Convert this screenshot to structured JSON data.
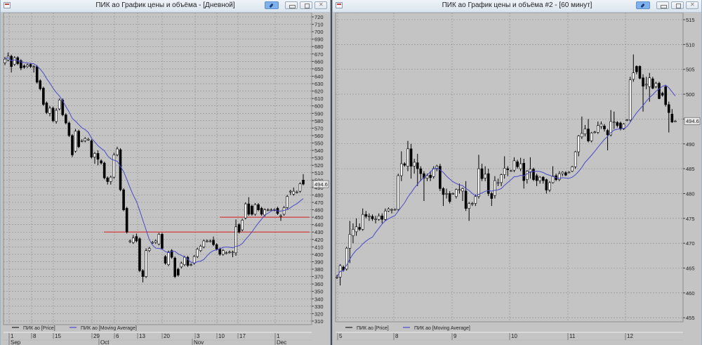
{
  "colors": {
    "plot_bg": "#c4c4c4",
    "grid": "#8c8c8c",
    "ma_line": "#4a4ac8",
    "level_line": "#d23c3c",
    "up_body": "#ffffff",
    "down_body": "#000000"
  },
  "left_window": {
    "title": "ПИК ао График цены и объёма - [Дневной]",
    "buttons": {
      "pin": "pin-icon",
      "minimize": "minimize-icon",
      "maximize": "maximize-icon",
      "close": "close-icon"
    },
    "legend": {
      "price": "ПИК ао [Price]",
      "ma": "ПИК ао [Moving Average]"
    },
    "last_price": "494.6",
    "chart_data": {
      "type": "candlestick",
      "ylim": [
        310,
        720
      ],
      "y_ticks": [
        "720",
        "710",
        "700",
        "690",
        "680",
        "670",
        "660",
        "650",
        "640",
        "630",
        "620",
        "610",
        "600",
        "590",
        "580",
        "570",
        "560",
        "550",
        "540",
        "530",
        "520",
        "510",
        "500",
        "490",
        "480",
        "470",
        "460",
        "450",
        "440",
        "430",
        "420",
        "410",
        "400",
        "390",
        "380",
        "370",
        "360",
        "350",
        "340",
        "330",
        "320",
        "310"
      ],
      "x_day_labels": [
        "1",
        "8",
        "15",
        "29",
        "6",
        "13",
        "20",
        "3",
        "10",
        "17",
        "1"
      ],
      "x_month_labels": [
        "Sep",
        "Oct",
        "Nov",
        "Dec"
      ],
      "grid": true,
      "horizontal_levels": [
        430,
        450
      ],
      "ohlc": [
        [
          658,
          666,
          655,
          663
        ],
        [
          662,
          672,
          660,
          667
        ],
        [
          667,
          669,
          645,
          653
        ],
        [
          656,
          667,
          654,
          665
        ],
        [
          665,
          667,
          655,
          657
        ],
        [
          661,
          663,
          648,
          651
        ],
        [
          654,
          656,
          650,
          652
        ],
        [
          653,
          657,
          651,
          655
        ],
        [
          656,
          658,
          651,
          653
        ],
        [
          653,
          655,
          645,
          653
        ],
        [
          653,
          655,
          630,
          632
        ],
        [
          634,
          636,
          621,
          623
        ],
        [
          624,
          626,
          600,
          602
        ],
        [
          604,
          606,
          589,
          591
        ],
        [
          590,
          600,
          586,
          597
        ],
        [
          597,
          599,
          578,
          580
        ],
        [
          579,
          597,
          576,
          594
        ],
        [
          596,
          610,
          594,
          608
        ],
        [
          608,
          610,
          586,
          588
        ],
        [
          588,
          590,
          575,
          577
        ],
        [
          577,
          579,
          558,
          560
        ],
        [
          560,
          562,
          531,
          534
        ],
        [
          539,
          569,
          537,
          566
        ],
        [
          566,
          568,
          543,
          545
        ],
        [
          553,
          555,
          551,
          553
        ],
        [
          553,
          558,
          551,
          556
        ],
        [
          555,
          557,
          553,
          555
        ],
        [
          553,
          555,
          529,
          531
        ],
        [
          531,
          538,
          522,
          536
        ],
        [
          536,
          540,
          520,
          528
        ],
        [
          526,
          528,
          521,
          523
        ],
        [
          523,
          525,
          501,
          503
        ],
        [
          503,
          505,
          494,
          498
        ],
        [
          498,
          506,
          494,
          504
        ],
        [
          504,
          537,
          502,
          534
        ],
        [
          534,
          545,
          532,
          542
        ],
        [
          541,
          543,
          485,
          487
        ],
        [
          487,
          489,
          458,
          460
        ],
        [
          462,
          464,
          428,
          430
        ],
        [
          418,
          420,
          415,
          418
        ],
        [
          416,
          426,
          414,
          422
        ],
        [
          424,
          428,
          416,
          418
        ],
        [
          421,
          423,
          376,
          378
        ],
        [
          378,
          380,
          362,
          370
        ],
        [
          370,
          408,
          368,
          405
        ],
        [
          405,
          410,
          403,
          408
        ],
        [
          416,
          418,
          414,
          416
        ],
        [
          416,
          420,
          414,
          418
        ],
        [
          414,
          429,
          412,
          427
        ],
        [
          427,
          429,
          406,
          408
        ],
        [
          397,
          399,
          386,
          388
        ],
        [
          386,
          405,
          384,
          403
        ],
        [
          405,
          407,
          394,
          396
        ],
        [
          395,
          397,
          368,
          370
        ],
        [
          380,
          382,
          370,
          372
        ],
        [
          383,
          390,
          381,
          388
        ],
        [
          386,
          398,
          384,
          396
        ],
        [
          396,
          398,
          383,
          385
        ],
        [
          386,
          388,
          384,
          386
        ],
        [
          388,
          399,
          386,
          397
        ],
        [
          397,
          409,
          395,
          407
        ],
        [
          405,
          413,
          403,
          411
        ],
        [
          410,
          420,
          408,
          418
        ],
        [
          418,
          420,
          416,
          418
        ],
        [
          418,
          420,
          416,
          418
        ],
        [
          419,
          424,
          411,
          413
        ],
        [
          413,
          415,
          405,
          407
        ],
        [
          407,
          409,
          398,
          400
        ],
        [
          400,
          407,
          398,
          405
        ],
        [
          402,
          404,
          400,
          402
        ],
        [
          403,
          405,
          401,
          403
        ],
        [
          403,
          405,
          396,
          403
        ],
        [
          402,
          447,
          398,
          437
        ],
        [
          440,
          442,
          428,
          430
        ],
        [
          433,
          448,
          431,
          446
        ],
        [
          449,
          470,
          447,
          468
        ],
        [
          468,
          477,
          452,
          454
        ],
        [
          465,
          467,
          452,
          454
        ],
        [
          454,
          469,
          452,
          467
        ],
        [
          467,
          469,
          458,
          460
        ],
        [
          462,
          464,
          452,
          454
        ],
        [
          453,
          462,
          451,
          460
        ],
        [
          460,
          462,
          458,
          460
        ],
        [
          460,
          462,
          458,
          460
        ],
        [
          460,
          462,
          458,
          460
        ],
        [
          462,
          464,
          453,
          455
        ],
        [
          452,
          454,
          445,
          452
        ],
        [
          454,
          465,
          452,
          463
        ],
        [
          463,
          480,
          461,
          478
        ],
        [
          485,
          487,
          480,
          485
        ],
        [
          481,
          490,
          479,
          485
        ],
        [
          484,
          486,
          482,
          484
        ],
        [
          485,
          497,
          483,
          495
        ],
        [
          500,
          508,
          493,
          494.6
        ]
      ]
    }
  },
  "right_window": {
    "title": "ПИК ао График цены и объёма #2 - [60 минут]",
    "buttons": {
      "pin": "pin-icon",
      "minimize": "minimize-icon",
      "maximize": "maximize-icon",
      "close": "close-icon"
    },
    "legend": {
      "price": "ПИК ао [Price]",
      "ma": "ПИК ао [Moving Average]"
    },
    "last_price": "494.6",
    "chart_data": {
      "type": "candlestick",
      "ylim": [
        455,
        515
      ],
      "y_ticks": [
        "515",
        "510",
        "505",
        "500",
        "495",
        "490",
        "485",
        "480",
        "475",
        "470",
        "465",
        "460",
        "455"
      ],
      "x_day_labels": [
        "5",
        "8",
        "9",
        "10",
        "11",
        "12"
      ],
      "grid": true,
      "ohlc": [
        [
          463.2,
          463.6,
          462.8,
          463.2
        ],
        [
          463.2,
          465.8,
          461.5,
          465.5
        ],
        [
          465.2,
          465.5,
          464.3,
          464.6
        ],
        [
          464.8,
          469.3,
          464.5,
          469
        ],
        [
          469,
          474.5,
          466,
          471.8
        ],
        [
          471.5,
          474,
          470,
          472.8
        ],
        [
          472.3,
          475,
          471.5,
          473.3
        ],
        [
          473.2,
          474,
          472.5,
          472.8
        ],
        [
          472.8,
          477,
          472.5,
          475.8
        ],
        [
          475.8,
          476.5,
          475,
          475.4
        ],
        [
          475.5,
          476,
          474.5,
          475.5
        ],
        [
          475.4,
          475.8,
          474.5,
          474.9
        ],
        [
          474.9,
          475.5,
          474,
          474.9
        ],
        [
          474.8,
          476,
          474.5,
          475.5
        ],
        [
          475.5,
          476,
          474,
          474.8
        ],
        [
          474.8,
          477,
          474.5,
          476.5
        ],
        [
          476.5,
          477.2,
          476.3,
          476.9
        ],
        [
          476.8,
          477,
          476,
          476.8
        ],
        [
          476.8,
          477,
          476.6,
          476.8
        ],
        [
          476.8,
          484,
          476.6,
          483.6
        ],
        [
          483.6,
          488.5,
          482.5,
          486
        ],
        [
          486,
          486.3,
          485.4,
          485.7
        ],
        [
          485.5,
          490.6,
          484.5,
          489
        ],
        [
          489,
          490,
          483,
          485.5
        ],
        [
          485.5,
          487,
          484,
          486.3
        ],
        [
          486.2,
          488,
          481.5,
          485
        ],
        [
          485,
          485.5,
          482.5,
          484
        ],
        [
          484,
          484.5,
          478.5,
          483.1
        ],
        [
          483.1,
          484,
          482.5,
          483.6
        ],
        [
          483.7,
          484.5,
          482.5,
          483.2
        ],
        [
          483.4,
          485.5,
          483,
          485
        ],
        [
          485,
          485.8,
          484.5,
          485.5
        ],
        [
          485.5,
          486,
          480.5,
          481
        ],
        [
          481,
          481.3,
          477.5,
          479.8
        ],
        [
          480,
          481,
          479,
          480
        ],
        [
          480,
          480.5,
          478,
          478.4
        ],
        [
          480,
          480.2,
          479.8,
          480
        ],
        [
          479.4,
          481,
          479,
          480.8
        ],
        [
          480.8,
          482,
          480,
          480.8
        ],
        [
          480.5,
          481.2,
          478.5,
          481
        ],
        [
          480.5,
          482.5,
          476.5,
          477
        ],
        [
          477,
          478.3,
          474.5,
          478
        ],
        [
          478,
          478.3,
          477.5,
          478
        ],
        [
          478,
          479.8,
          477.5,
          479.4
        ],
        [
          479.4,
          487.8,
          479,
          485
        ],
        [
          485,
          486,
          482.5,
          483
        ],
        [
          483.1,
          485.5,
          482.5,
          483.9
        ],
        [
          484,
          485,
          479.5,
          480
        ],
        [
          480,
          480.3,
          477.5,
          479
        ],
        [
          479.6,
          483.5,
          479,
          482.6
        ],
        [
          482.2,
          483,
          481.5,
          482.2
        ],
        [
          482.2,
          484,
          481.5,
          483.8
        ],
        [
          483.8,
          487.5,
          483,
          485.1
        ],
        [
          485,
          485.5,
          483.5,
          484.8
        ],
        [
          484.6,
          484.8,
          484.4,
          484.6
        ],
        [
          484.7,
          487.3,
          484.3,
          486.6
        ],
        [
          486.4,
          486.8,
          485,
          485.4
        ],
        [
          485,
          487.2,
          484.5,
          486
        ],
        [
          486.1,
          487,
          481,
          482.6
        ],
        [
          482.8,
          484.7,
          482,
          484.5
        ],
        [
          484.3,
          487.3,
          483,
          484.9
        ],
        [
          484.9,
          485.2,
          482.5,
          482.8
        ],
        [
          483.6,
          484,
          481.5,
          482.6
        ],
        [
          482.6,
          483.5,
          482,
          483.3
        ],
        [
          483.3,
          483.5,
          482,
          482.6
        ],
        [
          482.8,
          483,
          480,
          480.7
        ],
        [
          480.7,
          482.5,
          480.3,
          482.2
        ],
        [
          482.2,
          485.5,
          482,
          483.5
        ],
        [
          483.6,
          484,
          482.5,
          482.8
        ],
        [
          482.8,
          484.5,
          482.5,
          484
        ],
        [
          484,
          484.5,
          483.5,
          484.3
        ],
        [
          484.2,
          484.5,
          483.5,
          483.7
        ],
        [
          484.3,
          484.5,
          484.1,
          484.3
        ],
        [
          484.5,
          485.6,
          484.3,
          485.4
        ],
        [
          485.4,
          488.6,
          485,
          488.4
        ],
        [
          488.4,
          491.8,
          487.5,
          491.6
        ],
        [
          491.4,
          495.5,
          491,
          492.1
        ],
        [
          492,
          493.8,
          491.5,
          493
        ],
        [
          493,
          495,
          490.3,
          490.6
        ],
        [
          490.6,
          492.4,
          490.3,
          492.2
        ],
        [
          492.3,
          492.6,
          492.1,
          492.4
        ],
        [
          492.3,
          494.5,
          492,
          493.7
        ],
        [
          493.5,
          494.5,
          493,
          494
        ],
        [
          493.6,
          494,
          492.5,
          493
        ],
        [
          492.7,
          493,
          488.7,
          491.8
        ],
        [
          491.8,
          496.8,
          491.5,
          494.5
        ],
        [
          494.4,
          496.5,
          493,
          494.4
        ],
        [
          494.3,
          494.6,
          493.3,
          493.7
        ],
        [
          494.2,
          494.5,
          492.7,
          493
        ],
        [
          493,
          494.2,
          492.8,
          494
        ],
        [
          494.8,
          495,
          494.6,
          494.8
        ],
        [
          494.8,
          503.5,
          494.5,
          502.9
        ],
        [
          503,
          508,
          502.5,
          504.3
        ],
        [
          505.6,
          505.8,
          504,
          504.5
        ],
        [
          505.6,
          505.8,
          503,
          503.2
        ],
        [
          503.3,
          504,
          496.5,
          501.6
        ],
        [
          502,
          503.5,
          501,
          502
        ],
        [
          501.5,
          504.3,
          498.5,
          503.3
        ],
        [
          503.1,
          503.5,
          501,
          501.2
        ],
        [
          501.5,
          502.5,
          501.2,
          502.2
        ],
        [
          502.2,
          502.5,
          499,
          499.1
        ],
        [
          500.2,
          500.5,
          499.5,
          499.8
        ],
        [
          501.5,
          501.8,
          497.5,
          497.9
        ],
        [
          497.9,
          498.5,
          492.3,
          496.3
        ],
        [
          496,
          497,
          494.2,
          494.4
        ],
        [
          494.6,
          494.8,
          494.4,
          494.6
        ]
      ]
    }
  }
}
